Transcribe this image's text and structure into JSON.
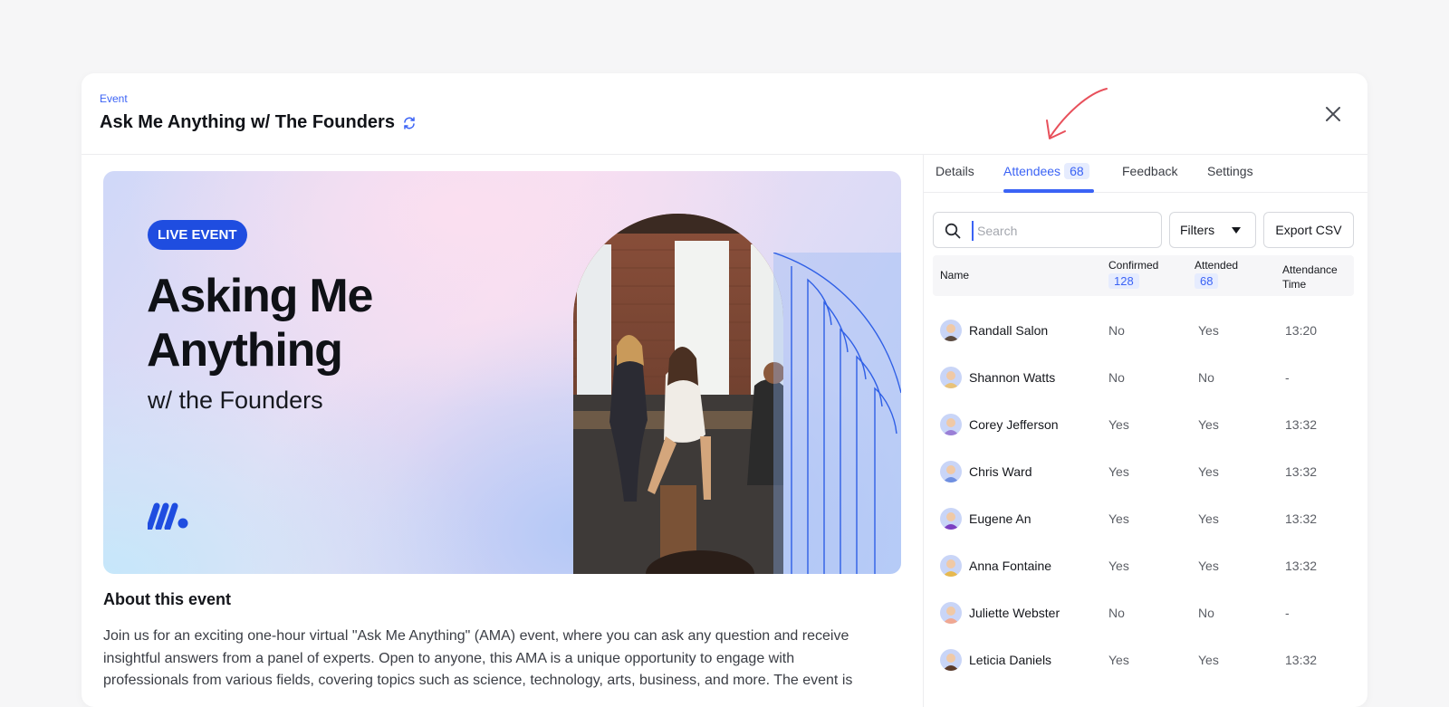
{
  "header": {
    "eyebrow": "Event",
    "title": "Ask Me Anything w/ The Founders"
  },
  "hero": {
    "pill": "LIVE EVENT",
    "headline": "Asking Me Anything",
    "subhead": "w/ the Founders"
  },
  "about": {
    "title": "About this event",
    "text": "Join us for an exciting one-hour virtual \"Ask Me Anything\" (AMA) event, where you can ask any question and receive insightful answers from a panel of experts. Open to anyone, this AMA is a unique opportunity to engage with professionals from various fields, covering topics such as science, technology, arts, business, and more. The event is"
  },
  "tabs": [
    {
      "label": "Details"
    },
    {
      "label": "Attendees",
      "count": "68"
    },
    {
      "label": "Feedback"
    },
    {
      "label": "Settings"
    }
  ],
  "toolbar": {
    "search_placeholder": "Search",
    "filters_label": "Filters",
    "export_label": "Export CSV"
  },
  "table": {
    "headers": {
      "name": "Name",
      "confirmed": "Confirmed",
      "confirmed_count": "128",
      "attended": "Attended",
      "attended_count": "68",
      "time": "Attendance Time"
    },
    "rows": [
      {
        "name": "Randall Salon",
        "confirmed": "No",
        "attended": "Yes",
        "time": "13:20",
        "avatar_color": "#5b4a3f"
      },
      {
        "name": "Shannon Watts",
        "confirmed": "No",
        "attended": "No",
        "time": "-",
        "avatar_color": "#e8c27a"
      },
      {
        "name": "Corey Jefferson",
        "confirmed": "Yes",
        "attended": "Yes",
        "time": "13:32",
        "avatar_color": "#9a7fd6"
      },
      {
        "name": "Chris Ward",
        "confirmed": "Yes",
        "attended": "Yes",
        "time": "13:32",
        "avatar_color": "#6f8fe0"
      },
      {
        "name": "Eugene An",
        "confirmed": "Yes",
        "attended": "Yes",
        "time": "13:32",
        "avatar_color": "#7b3fc2"
      },
      {
        "name": "Anna Fontaine",
        "confirmed": "Yes",
        "attended": "Yes",
        "time": "13:32",
        "avatar_color": "#e7b94f"
      },
      {
        "name": "Juliette Webster",
        "confirmed": "No",
        "attended": "No",
        "time": "-",
        "avatar_color": "#f0a892"
      },
      {
        "name": "Leticia Daniels",
        "confirmed": "Yes",
        "attended": "Yes",
        "time": "13:32",
        "avatar_color": "#5a3a2a"
      }
    ]
  },
  "colors": {
    "accent": "#3b63f5",
    "pill": "#1f4de0",
    "annotation_arrow": "#e8505b"
  }
}
